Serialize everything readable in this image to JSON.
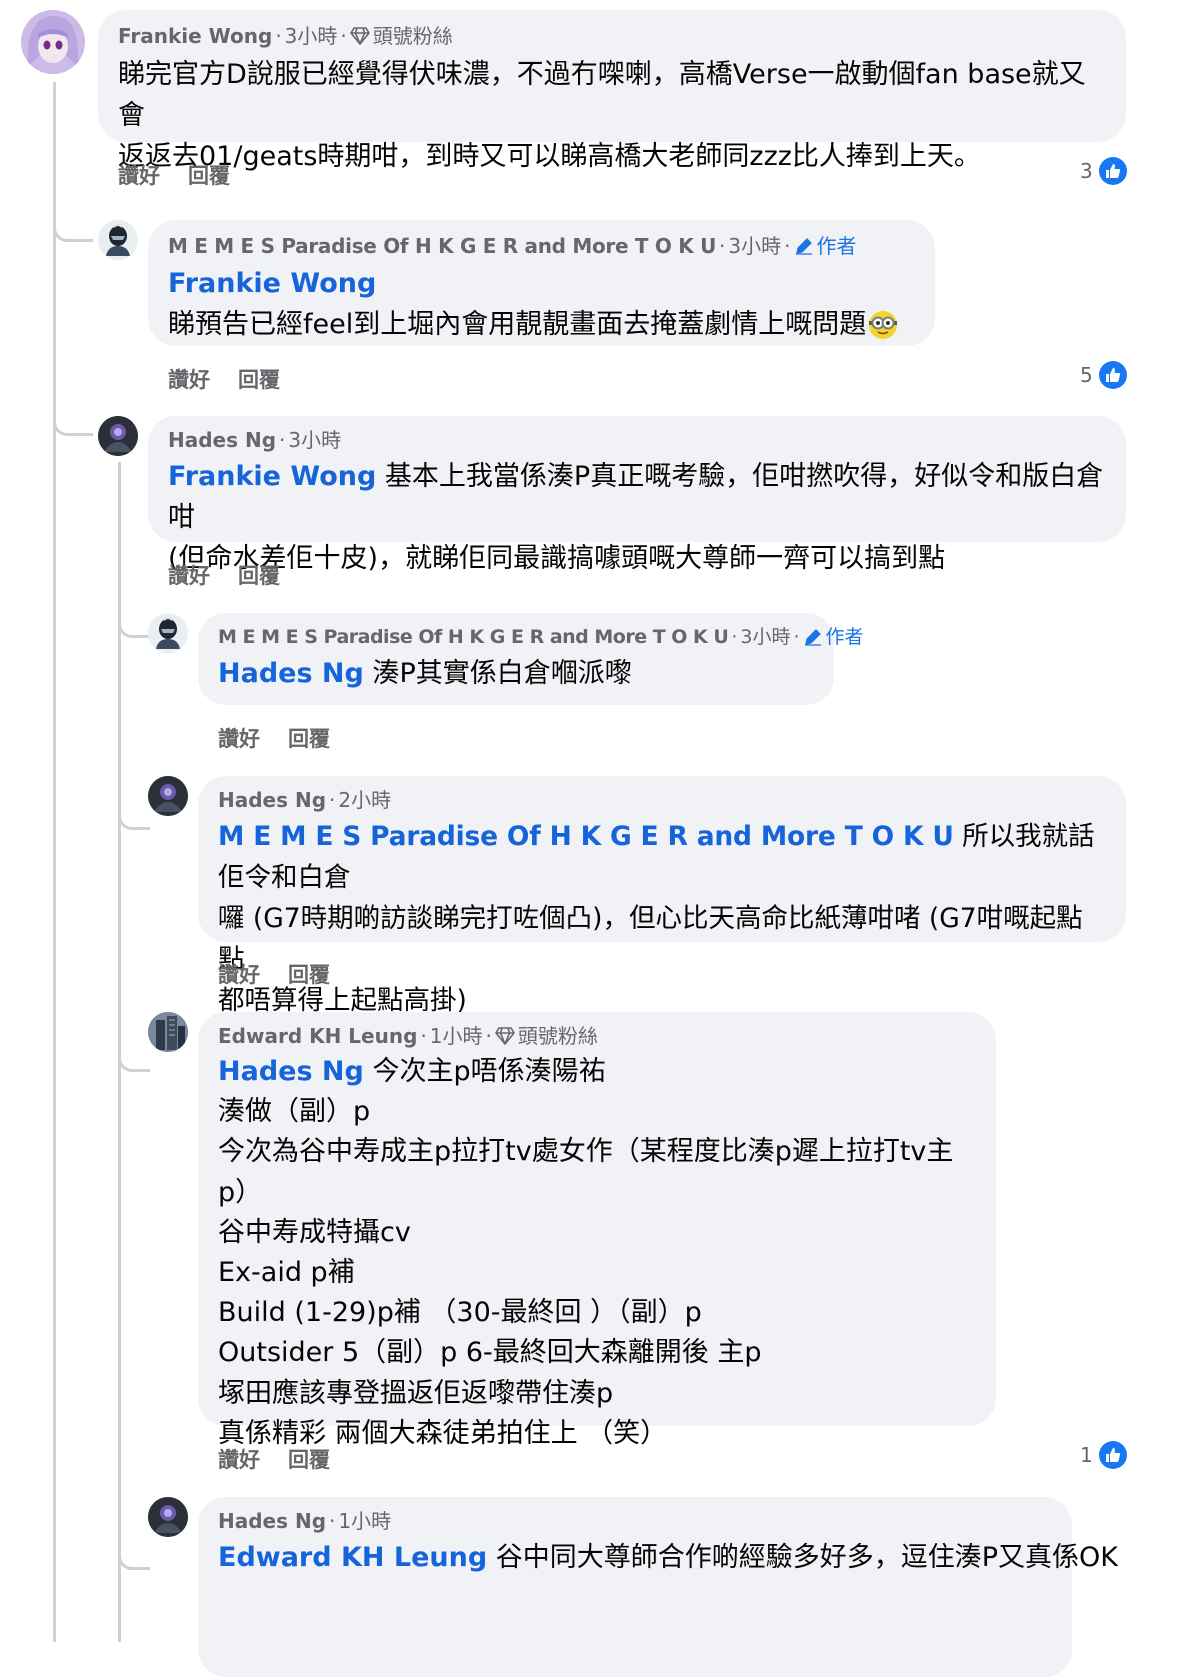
{
  "actions": {
    "like": "讚好",
    "reply": "回覆"
  },
  "comments": [
    {
      "author": "Frankie Wong",
      "time": "3小時",
      "badge": "頭號粉絲",
      "lines": [
        "睇完官方D說服已經覺得伏味濃，不過冇㗎喇，高橋Verse一啟動個fan base就又會",
        "返返去01/geats時期咁，到時又可以睇高橋大老師同zzz比人捧到上天。"
      ],
      "reactions": "3"
    },
    {
      "author": "M E M E S Paradise Of H K G E R and More T O K U",
      "time": "3小時",
      "author_tag": "作者",
      "mention": "Frankie Wong",
      "lines": [
        "睇預告已經feel到上堀內會用靚靚畫面去掩蓋劇情上嘅問題￼"
      ],
      "reactions": "5"
    },
    {
      "author": "Hades Ng",
      "time": "3小時",
      "mention": "Frankie Wong",
      "lines_after_mention": " 基本上我當係湊P真正嘅考驗，佢咁撚吹得，好似令和版白倉咁",
      "lines": [
        "(但命水差佢十皮)，就睇佢同最識搞噱頭嘅大尊師一齊可以搞到點"
      ]
    },
    {
      "author": "M E M E S Paradise Of H K G E R and More T O K U",
      "time": "3小時",
      "author_tag": "作者",
      "mention": "Hades Ng",
      "lines_after_mention": " 湊P其實係白倉嗰派嚟"
    },
    {
      "author": "Hades Ng",
      "time": "2小時",
      "mention": "M E M E S Paradise Of H K G E R and More T O K U",
      "lines_after_mention": " 所以我就話佢令和白倉",
      "lines": [
        "囉 (G7時期啲訪談睇完打咗個凸)，但心比天高命比紙薄咁啫 (G7咁嘅起點點",
        "都唔算得上起點高掛)"
      ]
    },
    {
      "author": "Edward KH Leung",
      "time": "1小時",
      "badge": "頭號粉絲",
      "mention": "Hades Ng",
      "lines_after_mention": " 今次主p唔係湊陽祐",
      "lines": [
        "湊做（副）p",
        "今次為谷中寿成主p拉打tv處女作（某程度比湊p遲上拉打tv主p）",
        "谷中寿成特攝cv",
        "Ex-aid p補",
        "Build (1-29)p補 （30-最終回 ）（副）p",
        "Outsider 5（副）p 6-最終回大森離開後 主p",
        "塚田應該專登搵返佢返嚟帶住湊p",
        "真係精彩 兩個大森徒弟拍住上 （笑）"
      ],
      "reactions": "1"
    },
    {
      "author": "Hades Ng",
      "time": "1小時",
      "mention": "Edward KH Leung",
      "lines_after_mention": " 谷中同大尊師合作啲經驗多好多，逗住湊P又真係OK"
    }
  ]
}
